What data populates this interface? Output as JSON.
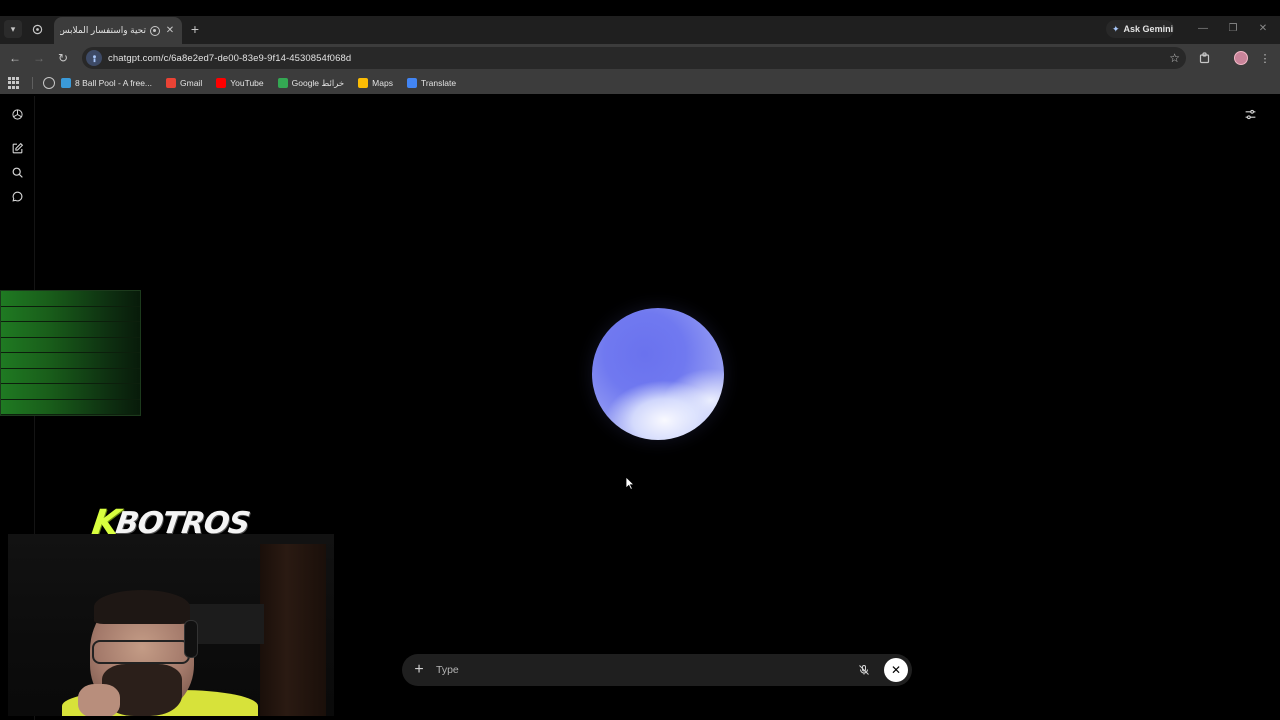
{
  "browser": {
    "tab": {
      "title": "تحية واستفسار الملابس"
    },
    "gemini_label": "Ask Gemini",
    "url": "chatgpt.com/c/6a8e2ed7-de00-83e9-9f14-4530854f068d",
    "bookmarks": [
      {
        "label": "8 Ball Pool - A free...",
        "icon": "pool-icon",
        "color": "#3a9ad9"
      },
      {
        "label": "Gmail",
        "icon": "gmail-icon",
        "color": "#ea4335"
      },
      {
        "label": "YouTube",
        "icon": "youtube-icon",
        "color": "#ff0000"
      },
      {
        "label": "Google خرائط",
        "icon": "maps-pin-icon",
        "color": "#34a853"
      },
      {
        "label": "Maps",
        "icon": "maps-pin-icon",
        "color": "#fbbc04"
      },
      {
        "label": "Translate",
        "icon": "translate-icon",
        "color": "#4285f4"
      }
    ]
  },
  "sidebar": {
    "items": [
      {
        "name": "chatgpt-logo-icon"
      },
      {
        "name": "new-chat-icon"
      },
      {
        "name": "search-icon"
      },
      {
        "name": "chats-icon"
      }
    ]
  },
  "composer": {
    "placeholder": "Type"
  },
  "overlay": {
    "brand_k": "K",
    "brand_rest": "BOTROS"
  },
  "colors": {
    "orb": "#7079f0",
    "page_bg": "#000000",
    "composer_bg": "#1f1f1f",
    "brand_accent": "#d9ff3f"
  }
}
